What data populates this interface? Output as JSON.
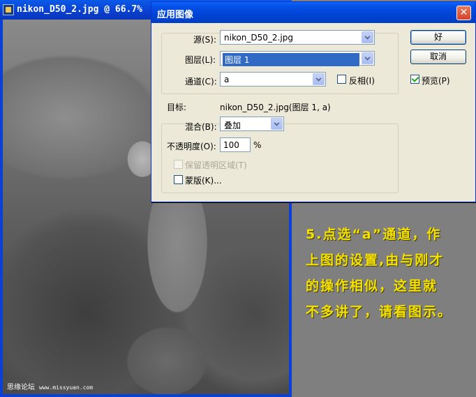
{
  "document": {
    "title": "nikon_D50_2.jpg @ 66.7%",
    "watermark_brand": "思缘论坛",
    "watermark_url": "www.missyuan.com"
  },
  "dialog": {
    "title": "应用图像",
    "source": {
      "label": "源(S):",
      "value": "nikon_D50_2.jpg"
    },
    "layer": {
      "label": "图层(L):",
      "value": "图层 1"
    },
    "channel": {
      "label": "通道(C):",
      "value": "a"
    },
    "invert": {
      "label": "反相(I)",
      "checked": false
    },
    "target": {
      "label": "目标:",
      "value": "nikon_D50_2.jpg(图层 1, a)"
    },
    "blending": {
      "label": "混合(B):",
      "value": "叠加"
    },
    "opacity": {
      "label": "不透明度(O):",
      "value": "100",
      "unit": "%"
    },
    "preserve_transparency": {
      "label": "保留透明区域(T)",
      "checked": false,
      "enabled": false
    },
    "mask": {
      "label": "蒙版(K)...",
      "checked": false
    },
    "ok_label": "好",
    "cancel_label": "取消",
    "preview": {
      "label": "预览(P)",
      "checked": true
    }
  },
  "annotation": {
    "lines": [
      "5.点选“a”通道，作",
      "上图的设置,由与刚才",
      "的操作相似，这里就",
      "不多讲了，请看图示。"
    ]
  },
  "colors": {
    "note_text": "#f5e000",
    "titlebar": "#0044d6",
    "dialog_bg": "#ece9d8"
  }
}
